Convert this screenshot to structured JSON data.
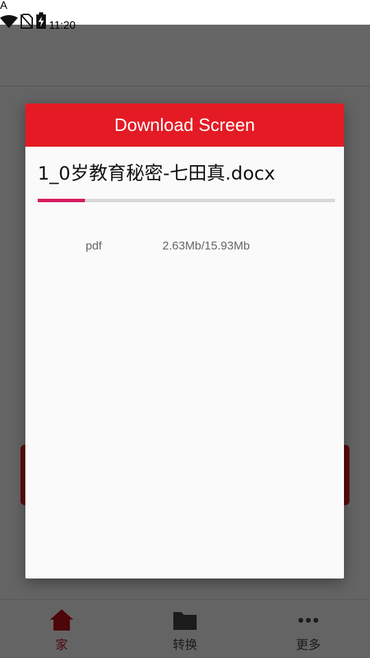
{
  "status_bar": {
    "time": "11:20"
  },
  "dialog": {
    "title": "Download Screen",
    "file_name": "1_0岁教育秘密-七田真.docx",
    "progress": 0.16,
    "file_type": "pdf",
    "size_progress": "2.63Mb/15.93Mb"
  },
  "bottom_nav": {
    "items": [
      {
        "label": "家",
        "icon": "home-icon"
      },
      {
        "label": "转换",
        "icon": "folder-icon"
      },
      {
        "label": "更多",
        "icon": "more-icon"
      }
    ]
  },
  "colors": {
    "accent": "#e41b24",
    "progress": "#d81b60",
    "active_nav": "#c01018"
  }
}
